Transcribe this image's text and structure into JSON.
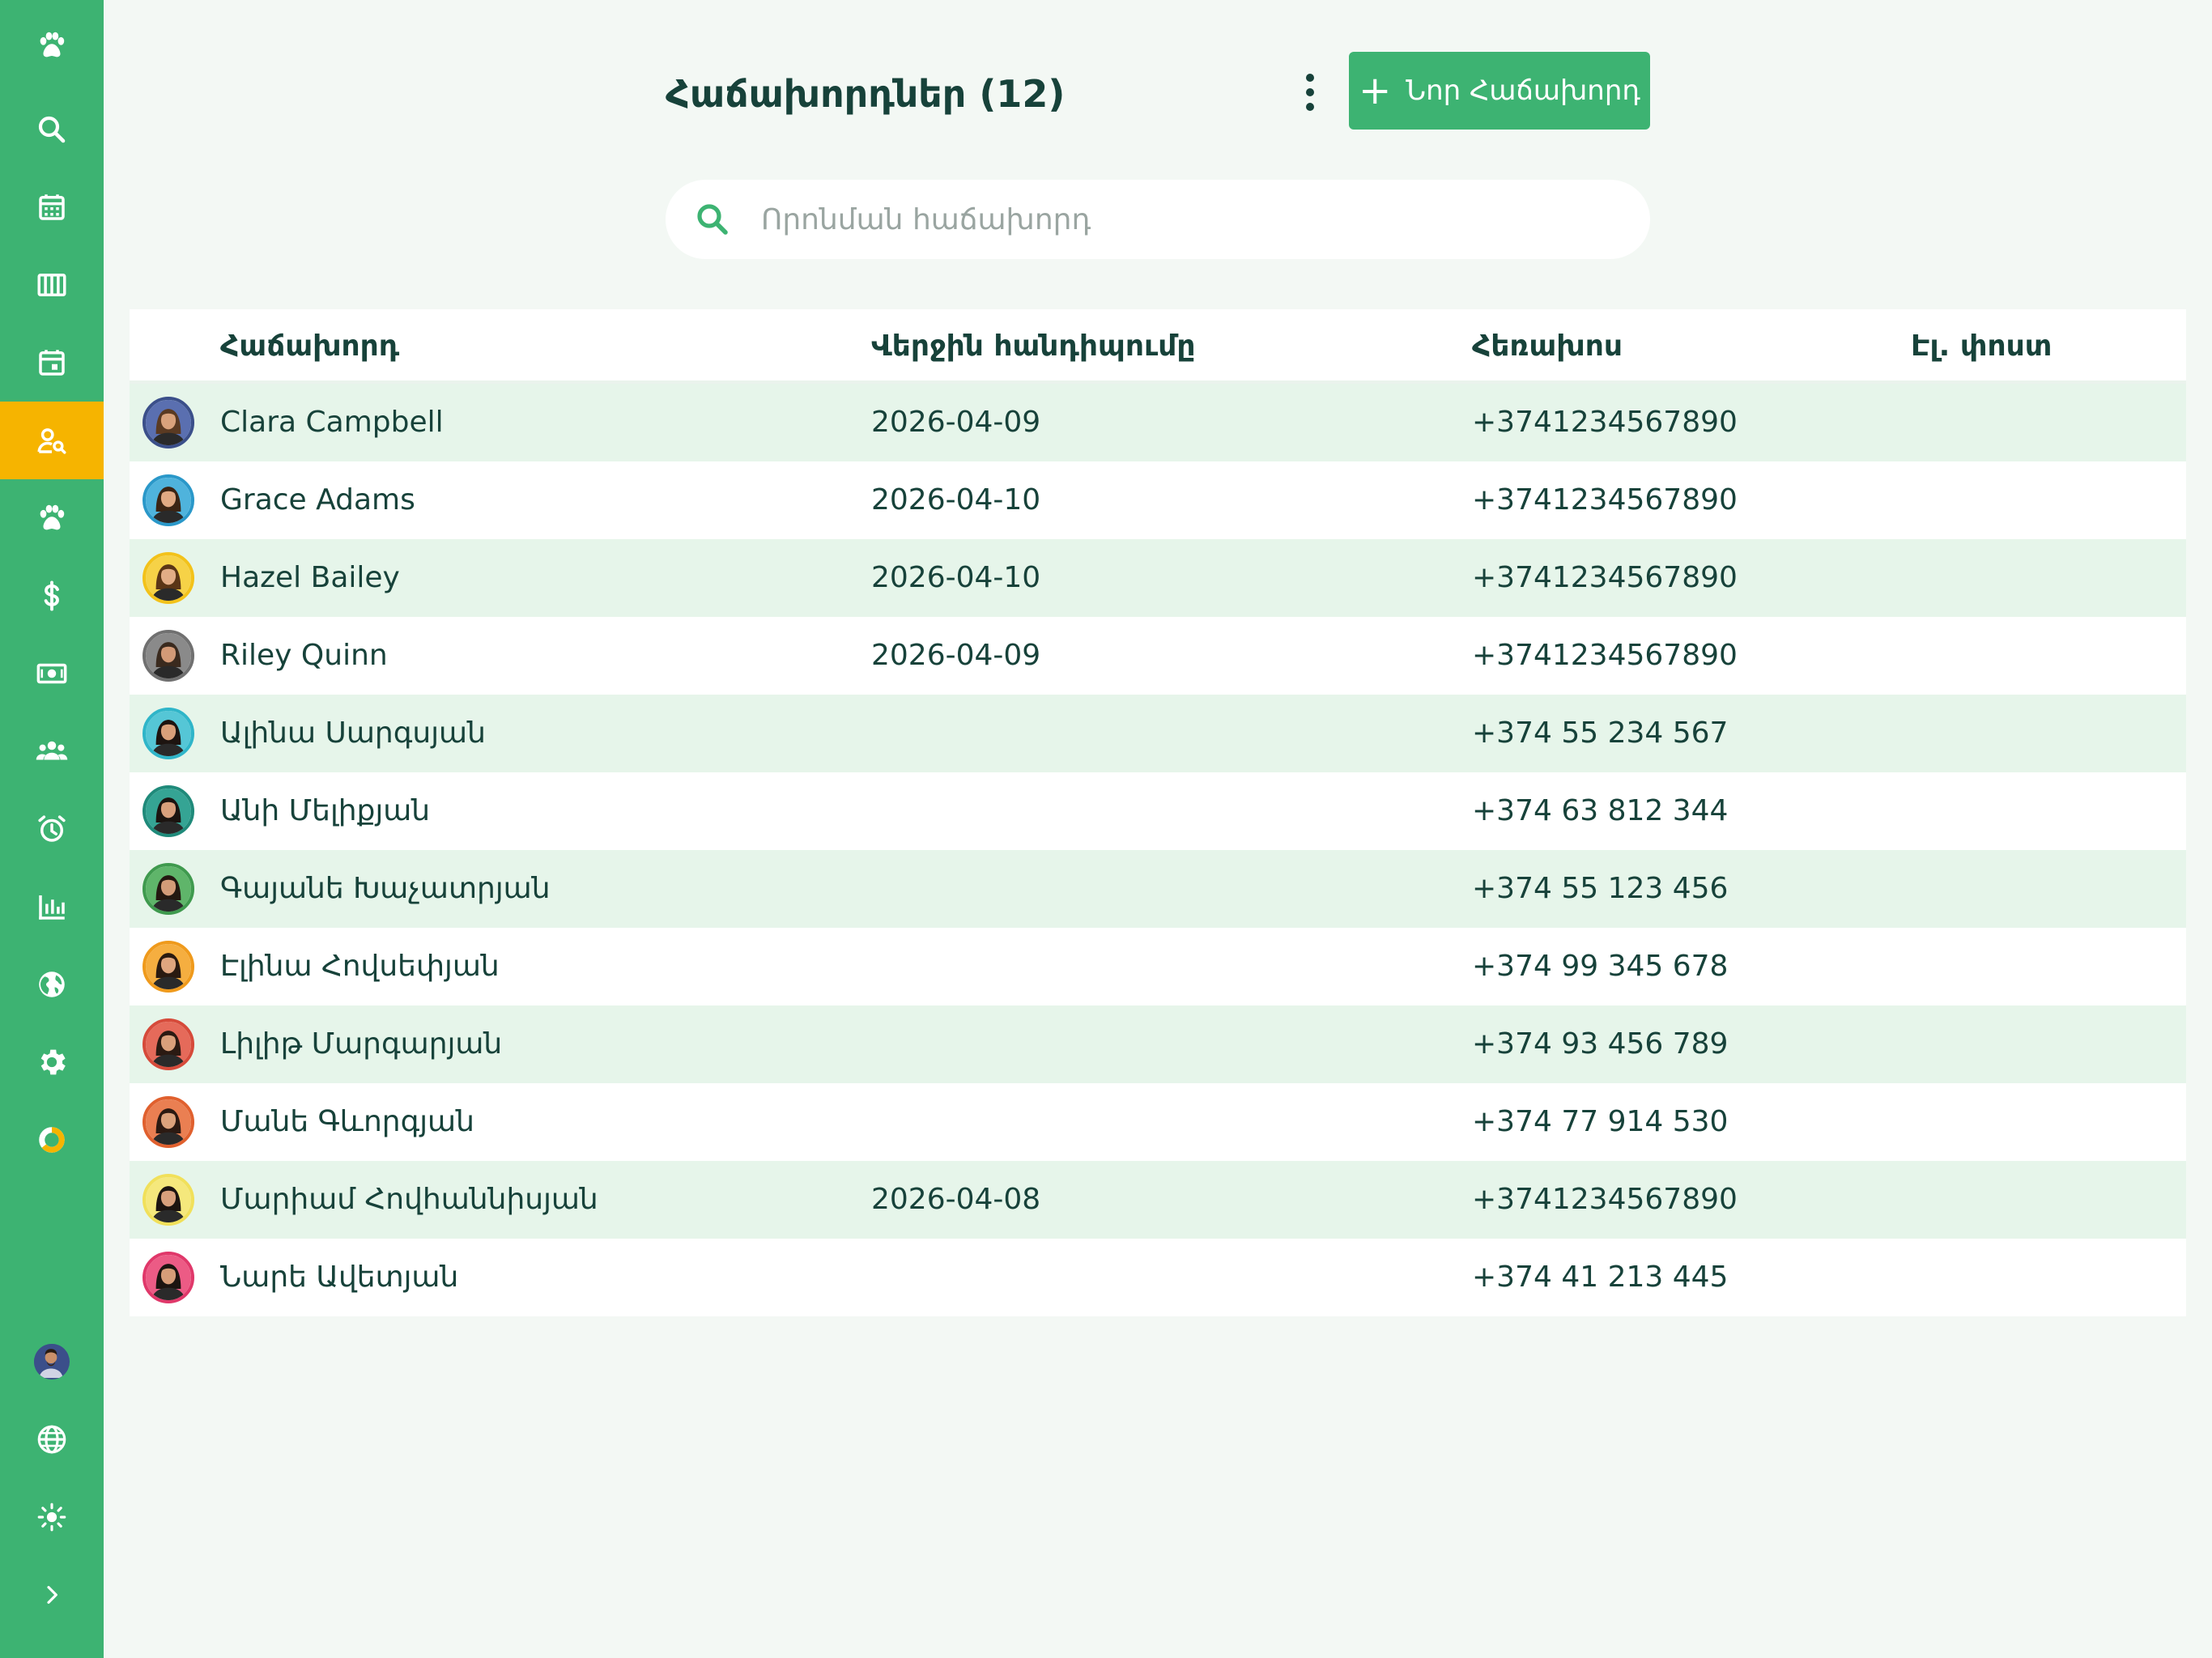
{
  "sidebar": {
    "items": [
      {
        "icon": "paw-icon"
      },
      {
        "icon": "search-icon"
      },
      {
        "icon": "calendar-icon"
      },
      {
        "icon": "columns-icon"
      },
      {
        "icon": "calendar-day-icon"
      },
      {
        "icon": "user-search-icon",
        "active": true
      },
      {
        "icon": "paw-icon"
      },
      {
        "icon": "dollar-icon"
      },
      {
        "icon": "cash-icon"
      },
      {
        "icon": "group-icon"
      },
      {
        "icon": "alarm-icon"
      },
      {
        "icon": "bar-chart-icon"
      },
      {
        "icon": "globe-filled-icon"
      },
      {
        "icon": "gear-icon"
      },
      {
        "icon": "donut-icon"
      }
    ],
    "bottom": [
      {
        "icon": "user-avatar"
      },
      {
        "icon": "globe-icon"
      },
      {
        "icon": "sun-icon"
      },
      {
        "icon": "chevron-right-icon"
      }
    ],
    "accent": "#3db372",
    "active_color": "#f6b400"
  },
  "header": {
    "title": "Հաճախորդներ (12)",
    "new_button": {
      "icon": "plus-icon",
      "label": "Նոր Հաճախորդ"
    }
  },
  "search": {
    "placeholder": "Որոնման հաճախորդ",
    "value": ""
  },
  "table": {
    "columns": [
      "Հաճախորդ",
      "Վերջին հանդիպումը",
      "Հեռախոս",
      "Էլ. փոստ"
    ],
    "rows": [
      {
        "name": "Clara Campbell",
        "last_visit": "2026-04-09",
        "phone": "+3741234567890",
        "email": "",
        "ring": "#3b4f8a",
        "hair": "#5a3a22",
        "skin": "#d9a27c",
        "bg": "#5a6fb0"
      },
      {
        "name": "Grace Adams",
        "last_visit": "2026-04-10",
        "phone": "+3741234567890",
        "email": "",
        "ring": "#2a98c9",
        "hair": "#3b2414",
        "skin": "#e0a983",
        "bg": "#4fb3dc"
      },
      {
        "name": "Hazel Bailey",
        "last_visit": "2026-04-10",
        "phone": "+3741234567890",
        "email": "",
        "ring": "#f3c21a",
        "hair": "#5a3516",
        "skin": "#e2ad86",
        "bg": "#f6d247"
      },
      {
        "name": "Riley Quinn",
        "last_visit": "2026-04-09",
        "phone": "+3741234567890",
        "email": "",
        "ring": "#707070",
        "hair": "#3a2a1e",
        "skin": "#d39a77",
        "bg": "#8a8a8a"
      },
      {
        "name": "Ալինա Սարգսյան",
        "last_visit": "",
        "phone": "+374 55 234 567",
        "email": "",
        "ring": "#2fb5c9",
        "hair": "#1d1410",
        "skin": "#d9a07a",
        "bg": "#55c6d6"
      },
      {
        "name": "Անի Մելիքյան",
        "last_visit": "",
        "phone": "+374 63 812 344",
        "email": "",
        "ring": "#1f8a7a",
        "hair": "#1b1410",
        "skin": "#d8a07c",
        "bg": "#35a494"
      },
      {
        "name": "Գայանե Խաչատրյան",
        "last_visit": "",
        "phone": "+374 55 123 456",
        "email": "",
        "ring": "#3f9a4e",
        "hair": "#241810",
        "skin": "#d49c78",
        "bg": "#5fb56a"
      },
      {
        "name": "Էլինա Հովսեփյան",
        "last_visit": "",
        "phone": "+374 99 345 678",
        "email": "",
        "ring": "#ef9a1c",
        "hair": "#2a1a10",
        "skin": "#dfa67f",
        "bg": "#f5ae40"
      },
      {
        "name": "Լիլիթ Մարգարյան",
        "last_visit": "",
        "phone": "+374 93 456 789",
        "email": "",
        "ring": "#d64a3a",
        "hair": "#2b1a12",
        "skin": "#daa07b",
        "bg": "#e56a5a"
      },
      {
        "name": "Մանե Գևորգյան",
        "last_visit": "",
        "phone": "+374 77 914 530",
        "email": "",
        "ring": "#e0602e",
        "hair": "#2c1a12",
        "skin": "#dca27c",
        "bg": "#ea7f52"
      },
      {
        "name": "Մարիամ Հովհաննիսյան",
        "last_visit": "2026-04-08",
        "phone": "+3741234567890",
        "email": "",
        "ring": "#f1e05a",
        "hair": "#1c1410",
        "skin": "#d8a07c",
        "bg": "#f5e87c"
      },
      {
        "name": "Նարե Ավետյան",
        "last_visit": "",
        "phone": "+374 41 213 445",
        "email": "",
        "ring": "#e0386a",
        "hair": "#1c1410",
        "skin": "#d69d78",
        "bg": "#ec5b85"
      }
    ]
  }
}
